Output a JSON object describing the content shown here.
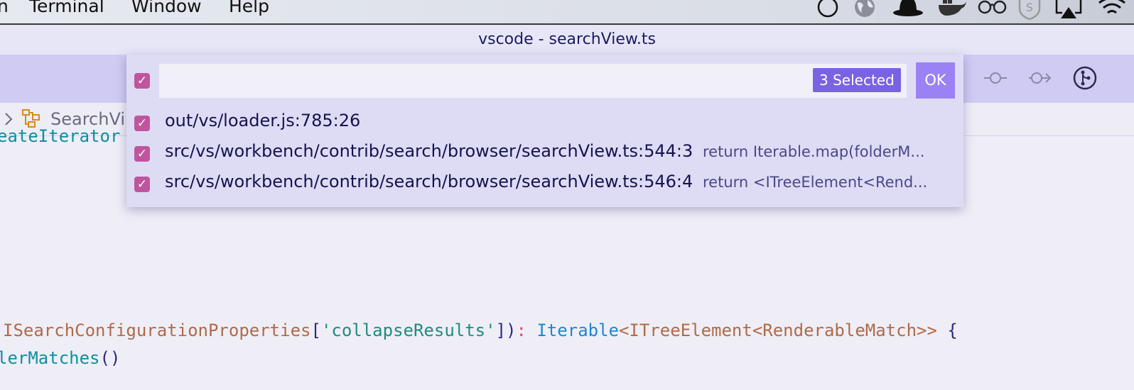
{
  "menubar": {
    "items": [
      "n",
      "Terminal",
      "Window",
      "Help"
    ],
    "tray_icons": [
      "circle-icon",
      "globe-icon",
      "bowler-hat-icon",
      "docker-whale-icon",
      "glasses-icon",
      "shield-s-icon",
      "airplay-icon",
      "wifi-icon"
    ]
  },
  "window": {
    "title": "vscode - searchView.ts"
  },
  "toolbar": {
    "icons": [
      "git-commit-icon",
      "git-forward-icon",
      "source-control-icon"
    ]
  },
  "breadcrumb": {
    "text": "SearchVi"
  },
  "editor": {
    "partial_line": "eateIterator",
    "line1": {
      "type": "ISearchConfigurationProperties",
      "open": "[",
      "string": "'collapseResults'",
      "close": "])",
      "colon": ":",
      "iface": "Iterable",
      "generic": "<ITreeElement<RenderableMatch>>",
      "brace": "{"
    },
    "line2": {
      "fn": "lerMatches",
      "parens": "()"
    }
  },
  "quickpick": {
    "input_value": "",
    "selected_count": "3 Selected",
    "ok_label": "OK",
    "items": [
      {
        "label": "out/vs/loader.js:785:26",
        "detail": "",
        "checked": true
      },
      {
        "label": "src/vs/workbench/contrib/search/browser/searchView.ts:544:3",
        "detail": "return Iterable.map(folderM...",
        "checked": true
      },
      {
        "label": "src/vs/workbench/contrib/search/browser/searchView.ts:546:4",
        "detail": "return <ITreeElement<Rend...",
        "checked": true
      }
    ]
  },
  "colors": {
    "accent": "#7a63e2",
    "ok_button": "#9a82f5",
    "checkbox": "#c0559e",
    "toolbar": "#cfcbf2"
  }
}
